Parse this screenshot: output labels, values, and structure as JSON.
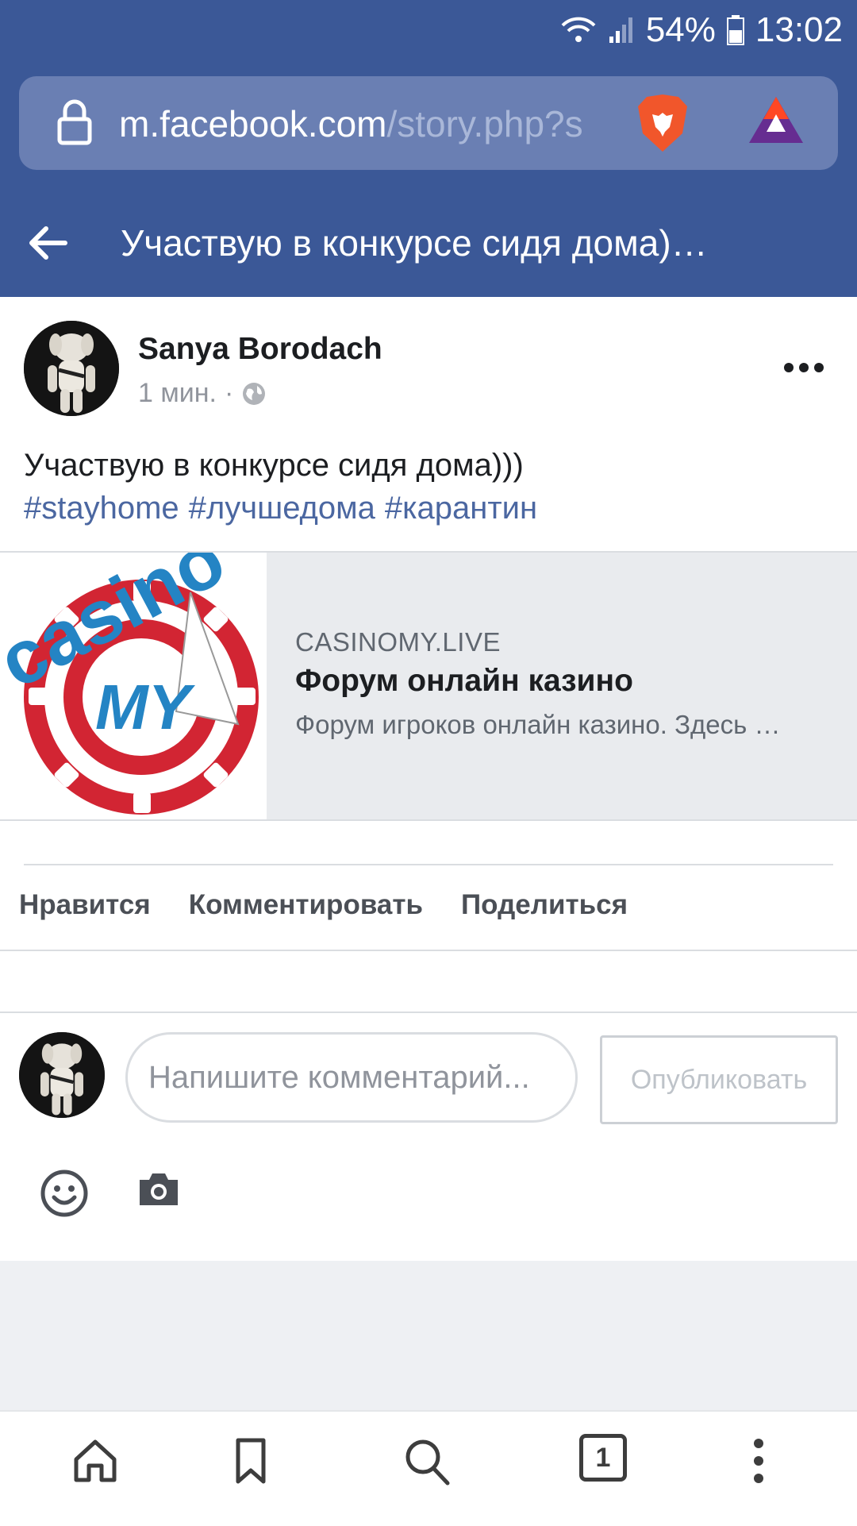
{
  "status_bar": {
    "battery": "54%",
    "time": "13:02"
  },
  "browser": {
    "url_domain": "m.facebook.com",
    "url_path": "/story.php?s",
    "icons": [
      "lock-icon",
      "brave-lion-icon",
      "bat-triangle-icon"
    ]
  },
  "page_header": {
    "title": "Участвую в конкурсе сидя дома)…"
  },
  "post": {
    "author": "Sanya Borodach",
    "time": "1 мин.",
    "separator": "·",
    "text": "Участвую в конкурсе сидя дома)))",
    "hashtags": [
      "#stayhome",
      "#лучшедома",
      "#карантин"
    ],
    "link": {
      "image_text_top": "casino",
      "image_text_center": "MY",
      "domain": "CASINOMY.LIVE",
      "title": "Форум онлайн казино",
      "description": "Форум игроков онлайн казино. Здесь …"
    },
    "actions": {
      "like": "Нравится",
      "comment": "Комментировать",
      "share": "Поделиться"
    }
  },
  "composer": {
    "placeholder": "Напишите комментарий...",
    "publish": "Опубликовать"
  },
  "bottom_nav": {
    "tabs_count": "1"
  },
  "colors": {
    "facebook_blue": "#3b5897",
    "hashtag": "#4b67a1"
  }
}
